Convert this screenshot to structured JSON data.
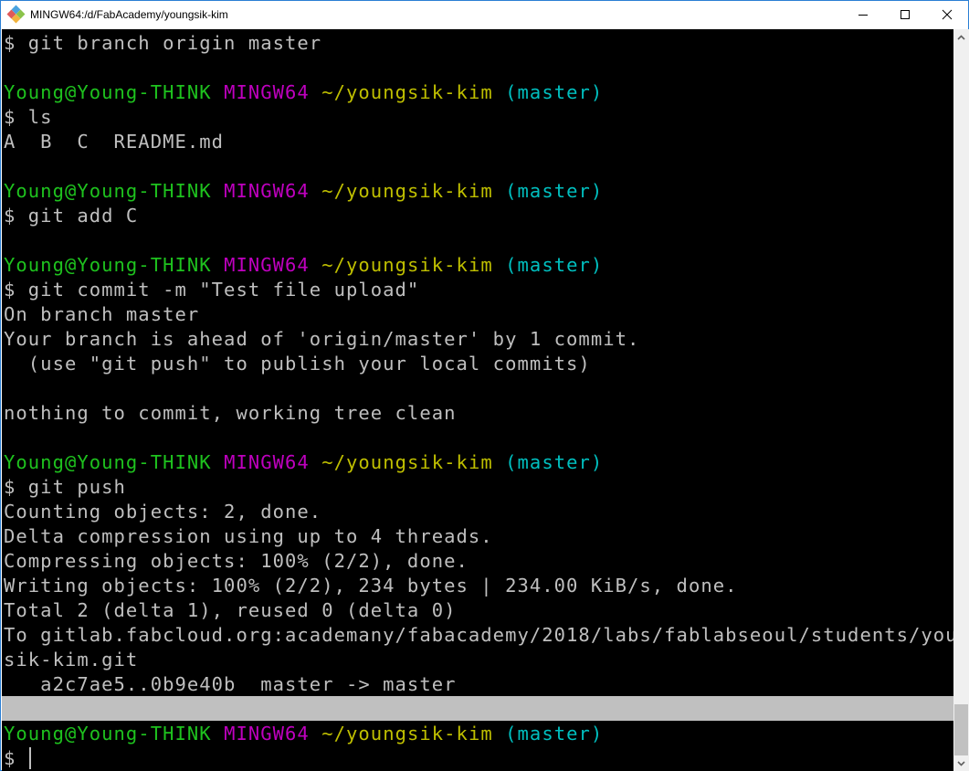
{
  "window": {
    "title": "MINGW64:/d/FabAcademy/youngsik-kim",
    "controls": [
      "minimize",
      "maximize",
      "close"
    ]
  },
  "colors": {
    "background": "#000000",
    "text": "#bfbfbf",
    "user_host": "#1ec21e",
    "shell": "#bf00bf",
    "path": "#bfbf00",
    "branch": "#00bfbf",
    "highlight": "#c0c0c0"
  },
  "prompt": {
    "user_host": "Young@Young-THINK",
    "shell": "MINGW64",
    "path": "~/youngsik-kim",
    "branch": "(master)",
    "symbol": "$"
  },
  "terminal": {
    "lines": [
      {
        "type": "cmd",
        "text": "$ git branch origin master"
      },
      {
        "type": "blank",
        "text": ""
      },
      {
        "type": "prompt"
      },
      {
        "type": "cmd",
        "text": "$ ls"
      },
      {
        "type": "out",
        "text": "A  B  C  README.md"
      },
      {
        "type": "blank",
        "text": ""
      },
      {
        "type": "prompt"
      },
      {
        "type": "cmd",
        "text": "$ git add C"
      },
      {
        "type": "blank",
        "text": ""
      },
      {
        "type": "prompt"
      },
      {
        "type": "cmd",
        "text": "$ git commit -m \"Test file upload\""
      },
      {
        "type": "out",
        "text": "On branch master"
      },
      {
        "type": "out",
        "text": "Your branch is ahead of 'origin/master' by 1 commit."
      },
      {
        "type": "out",
        "text": "  (use \"git push\" to publish your local commits)"
      },
      {
        "type": "blank",
        "text": ""
      },
      {
        "type": "out",
        "text": "nothing to commit, working tree clean"
      },
      {
        "type": "blank",
        "text": ""
      },
      {
        "type": "prompt"
      },
      {
        "type": "cmd",
        "text": "$ git push"
      },
      {
        "type": "out",
        "text": "Counting objects: 2, done."
      },
      {
        "type": "out",
        "text": "Delta compression using up to 4 threads."
      },
      {
        "type": "out",
        "text": "Compressing objects: 100% (2/2), done."
      },
      {
        "type": "out",
        "text": "Writing objects: 100% (2/2), 234 bytes | 234.00 KiB/s, done."
      },
      {
        "type": "out",
        "text": "Total 2 (delta 1), reused 0 (delta 0)"
      },
      {
        "type": "out",
        "text": "To gitlab.fabcloud.org:academany/fabacademy/2018/labs/fablabseoul/students/young"
      },
      {
        "type": "out",
        "text": "sik-kim.git"
      },
      {
        "type": "out",
        "text": "   a2c7ae5..0b9e40b  master -> master"
      },
      {
        "type": "highlight",
        "text": ""
      },
      {
        "type": "prompt"
      },
      {
        "type": "input",
        "text": "$ "
      }
    ]
  },
  "scrollbar": {
    "position_fraction": 1.0
  }
}
